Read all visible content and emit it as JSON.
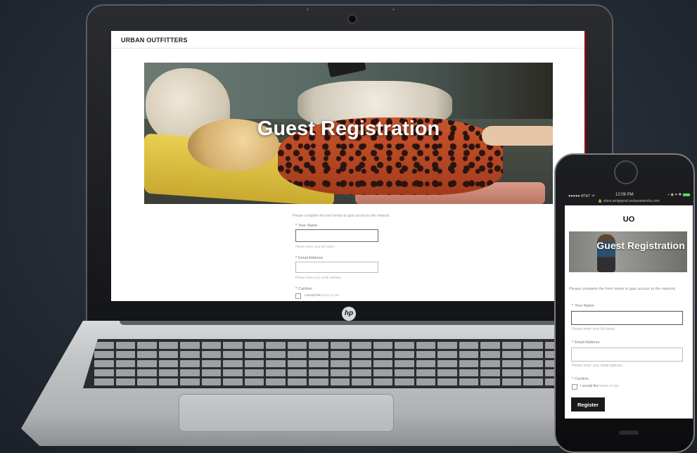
{
  "laptop": {
    "brand": "URBAN OUTFITTERS",
    "hero_title": "Guest Registration",
    "intro": "Please complete the form below to gain access to the network.",
    "fields": [
      {
        "label": "Your Name",
        "value": "",
        "hint": "Please enter your full name."
      },
      {
        "label": "Email Address",
        "value": "",
        "hint": "Please enter your email address."
      }
    ],
    "confirm_label": "Confirm:",
    "accept_text": "I accept the",
    "terms_link": "terms of use",
    "logo": "hp"
  },
  "phone": {
    "status": {
      "carrier": "●●●●● AT&T ᯤ",
      "time": "12:06 PM",
      "icons": "⌁ ◉ ➤ ✱",
      "url": "🔒 skins.amigopod.arubanetworks.com",
      "battery_color": "#5fd35a"
    },
    "brand": "UO",
    "hero_title": "Guest Registration",
    "intro": "Please complete the form below to gain access to the network.",
    "fields": [
      {
        "label": "Your Name:",
        "value": "",
        "hint": "Please enter your full name."
      },
      {
        "label": "Email Address:",
        "value": "",
        "hint": "Please enter your email address."
      }
    ],
    "confirm_label": "Confirm:",
    "accept_text": "I accept the",
    "terms_link": "terms of use",
    "register_label": "Register"
  },
  "colors": {
    "accent_button": "#1a1a1a",
    "required_marker": "#cc3333",
    "screen_edge": "#7a1010"
  }
}
